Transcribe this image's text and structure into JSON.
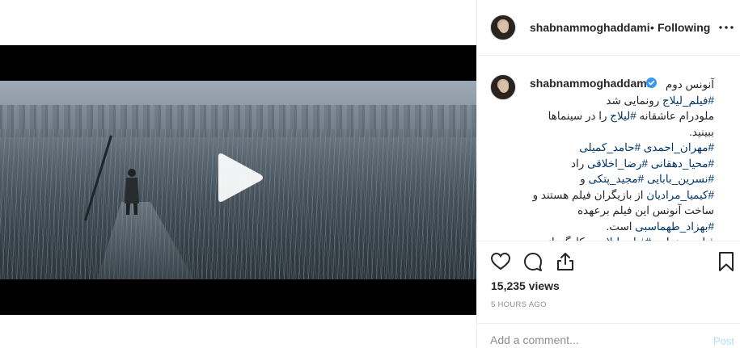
{
  "header": {
    "username": "shabnammoghaddami",
    "separator": "•",
    "follow_status": "Following"
  },
  "caption": {
    "username": "shabnammoghaddami",
    "lines": [
      [
        {
          "t": "آنونس دوم",
          "tag": false
        }
      ],
      [
        {
          "t": "#فیلم_لیلاج",
          "tag": true
        },
        {
          "t": " رونمایی شد",
          "tag": false
        }
      ],
      [
        {
          "t": "ملودرام عاشقانه ",
          "tag": false
        },
        {
          "t": "#لیلاج",
          "tag": true
        },
        {
          "t": " را در سینماها",
          "tag": false
        }
      ],
      [
        {
          "t": "ببینید.",
          "tag": false
        }
      ],
      [
        {
          "t": "#مهران_احمدی",
          "tag": true
        },
        {
          "t": " ",
          "tag": false
        },
        {
          "t": "#حامد_کمیلی",
          "tag": true
        }
      ],
      [
        {
          "t": "#محیا_دهقانی",
          "tag": true
        },
        {
          "t": " ",
          "tag": false
        },
        {
          "t": "#رضا_اخلاقی",
          "tag": true
        },
        {
          "t": " راد",
          "tag": false
        }
      ],
      [
        {
          "t": "#نسرین_بابایی",
          "tag": true
        },
        {
          "t": " ",
          "tag": false
        },
        {
          "t": "#مجید_پتکی",
          "tag": true
        },
        {
          "t": " و",
          "tag": false
        }
      ],
      [
        {
          "t": "#کیمیا_مرادیان",
          "tag": true
        },
        {
          "t": " از بازیگران فیلم هستند و",
          "tag": false
        }
      ],
      [
        {
          "t": "ساخت آنونس این فیلم برعهده",
          "tag": false
        }
      ],
      [
        {
          "t": "#بهزاد_طهماسبی",
          "tag": true
        },
        {
          "t": " است.",
          "tag": false
        }
      ],
      [
        {
          "t": "فیلم سینمایی ",
          "tag": false
        },
        {
          "t": "#فیلم_لیلاج",
          "tag": true
        },
        {
          "t": " به کارگردانی",
          "tag": false
        }
      ]
    ]
  },
  "stats": {
    "views": "15,235 views",
    "time": "5 HOURS AGO"
  },
  "comment": {
    "placeholder": "Add a comment...",
    "post_label": "Post"
  },
  "icons": {
    "like": "heart-icon",
    "comment": "comment-icon",
    "share": "share-icon",
    "save": "bookmark-icon",
    "more": "more-dots-icon",
    "play": "play-icon",
    "verified": "verified-badge-icon"
  },
  "colors": {
    "hashtag": "#003569",
    "post_disabled": "#b2dffc",
    "verified": "#3897f0",
    "meta_gray": "#8e8e8e"
  }
}
